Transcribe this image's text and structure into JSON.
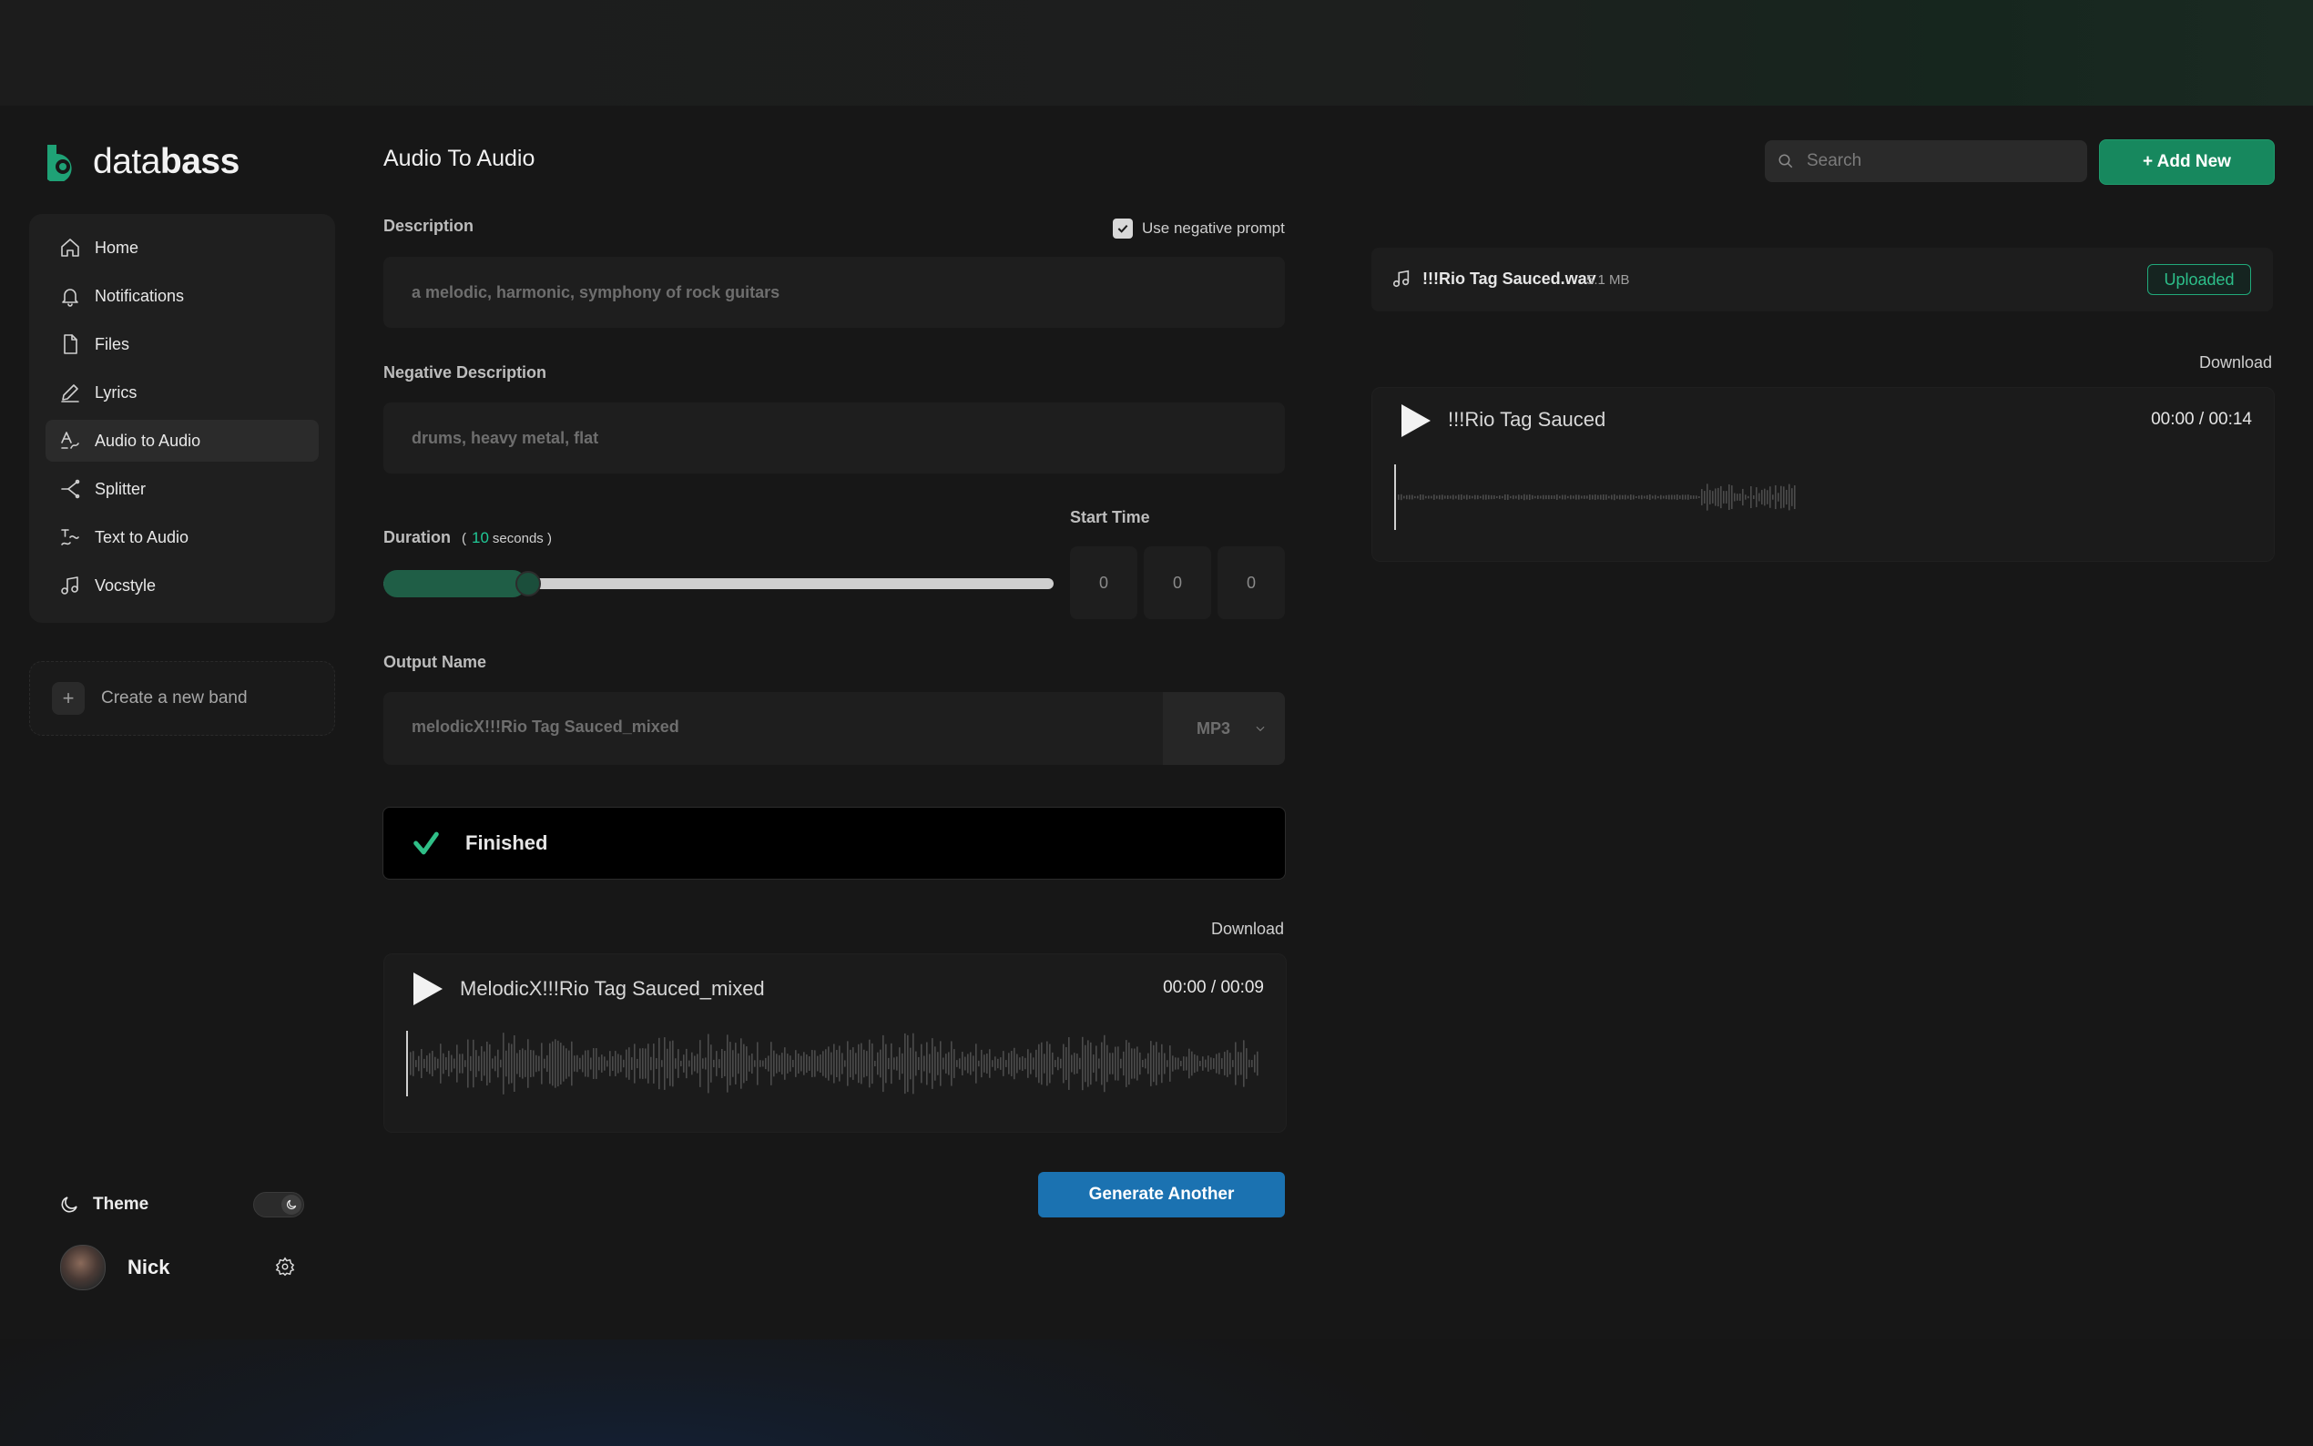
{
  "app": {
    "brand_light": "data",
    "brand_bold": "bass",
    "accent_color": "#17885e",
    "primary_button_color": "#1b72b1"
  },
  "header": {
    "title": "Audio To Audio",
    "search_placeholder": "Search",
    "add_new_label": "+ Add New"
  },
  "sidebar": {
    "items": [
      {
        "label": "Home",
        "icon": "home-icon"
      },
      {
        "label": "Notifications",
        "icon": "bell-icon"
      },
      {
        "label": "Files",
        "icon": "file-icon"
      },
      {
        "label": "Lyrics",
        "icon": "pencil-icon"
      },
      {
        "label": "Audio to Audio",
        "icon": "audio-to-audio-icon",
        "active": true
      },
      {
        "label": "Splitter",
        "icon": "splitter-icon"
      },
      {
        "label": "Text to Audio",
        "icon": "text-to-audio-icon"
      },
      {
        "label": "Vocstyle",
        "icon": "music-note-icon"
      }
    ],
    "create_band_label": "Create a new band",
    "theme_label": "Theme",
    "user_name": "Nick"
  },
  "form": {
    "description_label": "Description",
    "use_negative_prompt_label": "Use negative prompt",
    "use_negative_prompt_checked": true,
    "description_value": "a melodic, harmonic, symphony of rock guitars",
    "negative_description_label": "Negative Description",
    "negative_description_value": "drums, heavy metal, flat",
    "duration_label": "Duration",
    "duration_open": "(",
    "duration_value": "10",
    "duration_unit": "seconds",
    "duration_close": ")",
    "duration_fraction": 0.2,
    "start_time_label": "Start Time",
    "start_time_values": [
      "0",
      "0",
      "0"
    ],
    "output_name_label": "Output Name",
    "output_name_value": "melodicX!!!Rio Tag Sauced_mixed",
    "output_format": "MP3"
  },
  "status": {
    "text": "Finished"
  },
  "result_player": {
    "download_label": "Download",
    "title": "MelodicX!!!Rio Tag Sauced_mixed",
    "time": "00:00 / 00:09"
  },
  "generate_another_label": "Generate Another",
  "uploaded_file": {
    "name": "!!!Rio Tag Sauced.wav",
    "size": "5.1 MB",
    "status": "Uploaded"
  },
  "source_player": {
    "download_label": "Download",
    "title": "!!!Rio Tag Sauced",
    "time": "00:00 / 00:14"
  }
}
